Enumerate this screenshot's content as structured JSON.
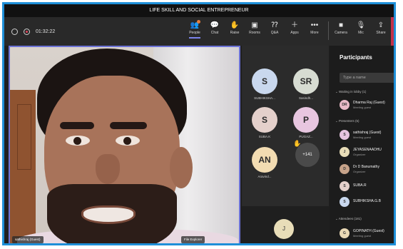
{
  "window": {
    "title": "LIFE SKILL AND SOCIAL ENTREPRENEUR"
  },
  "toolbar": {
    "timer": "01:32:22",
    "buttons": [
      {
        "label": "People",
        "icon": "people-icon",
        "glyph": "👥"
      },
      {
        "label": "Chat",
        "icon": "chat-icon",
        "glyph": "💬"
      },
      {
        "label": "Raise",
        "icon": "raise-hand-icon",
        "glyph": "✋"
      },
      {
        "label": "Rooms",
        "icon": "rooms-icon",
        "glyph": "▣"
      },
      {
        "label": "Q&A",
        "icon": "qa-icon",
        "glyph": "⁇"
      },
      {
        "label": "Apps",
        "icon": "apps-icon",
        "glyph": "＋"
      },
      {
        "label": "More",
        "icon": "more-icon",
        "glyph": "•••"
      }
    ],
    "devices": [
      {
        "label": "Camera",
        "icon": "camera-icon",
        "glyph": "■"
      },
      {
        "label": "Mic",
        "icon": "mic-icon",
        "glyph": "🎙"
      },
      {
        "label": "Share",
        "icon": "share-icon",
        "glyph": "⇪"
      }
    ]
  },
  "main_video": {
    "name_tag": "sathishraj (Guest)",
    "bottom_tag": "File Explorer"
  },
  "gallery": {
    "tiles": [
      {
        "initials": "S",
        "label": "SUBHIKSHA...",
        "color": "#c9d8ee"
      },
      {
        "initials": "SR",
        "label": "Sasindh...",
        "color": "#d7dcd2"
      },
      {
        "initials": "S",
        "label": "SUBA.K",
        "color": "#e4d0cb"
      },
      {
        "initials": "P",
        "label": "PUGAZ...",
        "color": "#e8c6e0"
      },
      {
        "initials": "AN",
        "label": "Aravind...",
        "color": "#f2dcb2"
      }
    ],
    "overflow_count": "+141",
    "bottom_initial": "J"
  },
  "participants": {
    "title": "Participants",
    "search_placeholder": "Type a name",
    "lobby_header": "Waiting in lobby (1)",
    "lobby": [
      {
        "initials": "DR",
        "name": "Dharma Raj (Guest)",
        "role": "Meeting guest",
        "color": "#e9b9c7"
      }
    ],
    "presenters_header": "Presenters (5)",
    "presenters": [
      {
        "initials": "S",
        "name": "sathishraj (Guest)",
        "role": "Meeting guest",
        "color": "#e5c3df"
      },
      {
        "initials": "J",
        "name": "JEYASENAADHU",
        "role": "Organizer",
        "color": "#e8ddb8"
      },
      {
        "initials": "D",
        "name": "Dr D Banumathy",
        "role": "Organizer",
        "color": "#c7a38a"
      },
      {
        "initials": "S",
        "name": "SUBA.R",
        "role": "",
        "color": "#e4d0cb"
      },
      {
        "initials": "S",
        "name": "SUBHIKSHA.G.B",
        "role": "",
        "color": "#c9d8ee"
      }
    ],
    "attendees_header": "Attendees (181)",
    "attendees": [
      {
        "initials": "G",
        "name": "GOPINATH (Guest)",
        "role": "Meeting guest",
        "color": "#ead9b5"
      }
    ]
  }
}
